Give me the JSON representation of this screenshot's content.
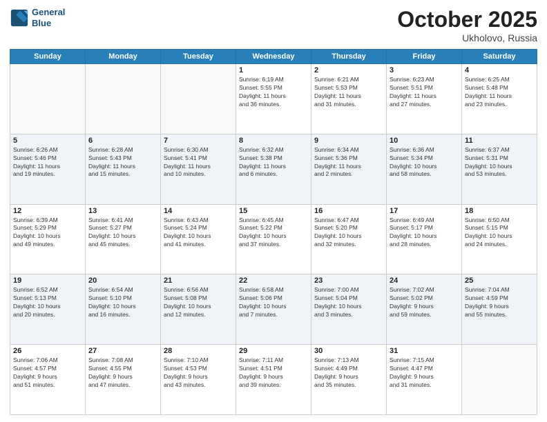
{
  "header": {
    "logo_line1": "General",
    "logo_line2": "Blue",
    "month": "October 2025",
    "location": "Ukholovo, Russia"
  },
  "days_of_week": [
    "Sunday",
    "Monday",
    "Tuesday",
    "Wednesday",
    "Thursday",
    "Friday",
    "Saturday"
  ],
  "weeks": [
    {
      "shaded": false,
      "days": [
        {
          "num": "",
          "lines": []
        },
        {
          "num": "",
          "lines": []
        },
        {
          "num": "",
          "lines": []
        },
        {
          "num": "1",
          "lines": [
            "Sunrise: 6:19 AM",
            "Sunset: 5:55 PM",
            "Daylight: 11 hours",
            "and 36 minutes."
          ]
        },
        {
          "num": "2",
          "lines": [
            "Sunrise: 6:21 AM",
            "Sunset: 5:53 PM",
            "Daylight: 11 hours",
            "and 31 minutes."
          ]
        },
        {
          "num": "3",
          "lines": [
            "Sunrise: 6:23 AM",
            "Sunset: 5:51 PM",
            "Daylight: 11 hours",
            "and 27 minutes."
          ]
        },
        {
          "num": "4",
          "lines": [
            "Sunrise: 6:25 AM",
            "Sunset: 5:48 PM",
            "Daylight: 11 hours",
            "and 23 minutes."
          ]
        }
      ]
    },
    {
      "shaded": true,
      "days": [
        {
          "num": "5",
          "lines": [
            "Sunrise: 6:26 AM",
            "Sunset: 5:46 PM",
            "Daylight: 11 hours",
            "and 19 minutes."
          ]
        },
        {
          "num": "6",
          "lines": [
            "Sunrise: 6:28 AM",
            "Sunset: 5:43 PM",
            "Daylight: 11 hours",
            "and 15 minutes."
          ]
        },
        {
          "num": "7",
          "lines": [
            "Sunrise: 6:30 AM",
            "Sunset: 5:41 PM",
            "Daylight: 11 hours",
            "and 10 minutes."
          ]
        },
        {
          "num": "8",
          "lines": [
            "Sunrise: 6:32 AM",
            "Sunset: 5:38 PM",
            "Daylight: 11 hours",
            "and 6 minutes."
          ]
        },
        {
          "num": "9",
          "lines": [
            "Sunrise: 6:34 AM",
            "Sunset: 5:36 PM",
            "Daylight: 11 hours",
            "and 2 minutes."
          ]
        },
        {
          "num": "10",
          "lines": [
            "Sunrise: 6:36 AM",
            "Sunset: 5:34 PM",
            "Daylight: 10 hours",
            "and 58 minutes."
          ]
        },
        {
          "num": "11",
          "lines": [
            "Sunrise: 6:37 AM",
            "Sunset: 5:31 PM",
            "Daylight: 10 hours",
            "and 53 minutes."
          ]
        }
      ]
    },
    {
      "shaded": false,
      "days": [
        {
          "num": "12",
          "lines": [
            "Sunrise: 6:39 AM",
            "Sunset: 5:29 PM",
            "Daylight: 10 hours",
            "and 49 minutes."
          ]
        },
        {
          "num": "13",
          "lines": [
            "Sunrise: 6:41 AM",
            "Sunset: 5:27 PM",
            "Daylight: 10 hours",
            "and 45 minutes."
          ]
        },
        {
          "num": "14",
          "lines": [
            "Sunrise: 6:43 AM",
            "Sunset: 5:24 PM",
            "Daylight: 10 hours",
            "and 41 minutes."
          ]
        },
        {
          "num": "15",
          "lines": [
            "Sunrise: 6:45 AM",
            "Sunset: 5:22 PM",
            "Daylight: 10 hours",
            "and 37 minutes."
          ]
        },
        {
          "num": "16",
          "lines": [
            "Sunrise: 6:47 AM",
            "Sunset: 5:20 PM",
            "Daylight: 10 hours",
            "and 32 minutes."
          ]
        },
        {
          "num": "17",
          "lines": [
            "Sunrise: 6:49 AM",
            "Sunset: 5:17 PM",
            "Daylight: 10 hours",
            "and 28 minutes."
          ]
        },
        {
          "num": "18",
          "lines": [
            "Sunrise: 6:50 AM",
            "Sunset: 5:15 PM",
            "Daylight: 10 hours",
            "and 24 minutes."
          ]
        }
      ]
    },
    {
      "shaded": true,
      "days": [
        {
          "num": "19",
          "lines": [
            "Sunrise: 6:52 AM",
            "Sunset: 5:13 PM",
            "Daylight: 10 hours",
            "and 20 minutes."
          ]
        },
        {
          "num": "20",
          "lines": [
            "Sunrise: 6:54 AM",
            "Sunset: 5:10 PM",
            "Daylight: 10 hours",
            "and 16 minutes."
          ]
        },
        {
          "num": "21",
          "lines": [
            "Sunrise: 6:56 AM",
            "Sunset: 5:08 PM",
            "Daylight: 10 hours",
            "and 12 minutes."
          ]
        },
        {
          "num": "22",
          "lines": [
            "Sunrise: 6:58 AM",
            "Sunset: 5:06 PM",
            "Daylight: 10 hours",
            "and 7 minutes."
          ]
        },
        {
          "num": "23",
          "lines": [
            "Sunrise: 7:00 AM",
            "Sunset: 5:04 PM",
            "Daylight: 10 hours",
            "and 3 minutes."
          ]
        },
        {
          "num": "24",
          "lines": [
            "Sunrise: 7:02 AM",
            "Sunset: 5:02 PM",
            "Daylight: 9 hours",
            "and 59 minutes."
          ]
        },
        {
          "num": "25",
          "lines": [
            "Sunrise: 7:04 AM",
            "Sunset: 4:59 PM",
            "Daylight: 9 hours",
            "and 55 minutes."
          ]
        }
      ]
    },
    {
      "shaded": false,
      "days": [
        {
          "num": "26",
          "lines": [
            "Sunrise: 7:06 AM",
            "Sunset: 4:57 PM",
            "Daylight: 9 hours",
            "and 51 minutes."
          ]
        },
        {
          "num": "27",
          "lines": [
            "Sunrise: 7:08 AM",
            "Sunset: 4:55 PM",
            "Daylight: 9 hours",
            "and 47 minutes."
          ]
        },
        {
          "num": "28",
          "lines": [
            "Sunrise: 7:10 AM",
            "Sunset: 4:53 PM",
            "Daylight: 9 hours",
            "and 43 minutes."
          ]
        },
        {
          "num": "29",
          "lines": [
            "Sunrise: 7:11 AM",
            "Sunset: 4:51 PM",
            "Daylight: 9 hours",
            "and 39 minutes."
          ]
        },
        {
          "num": "30",
          "lines": [
            "Sunrise: 7:13 AM",
            "Sunset: 4:49 PM",
            "Daylight: 9 hours",
            "and 35 minutes."
          ]
        },
        {
          "num": "31",
          "lines": [
            "Sunrise: 7:15 AM",
            "Sunset: 4:47 PM",
            "Daylight: 9 hours",
            "and 31 minutes."
          ]
        },
        {
          "num": "",
          "lines": []
        }
      ]
    }
  ]
}
